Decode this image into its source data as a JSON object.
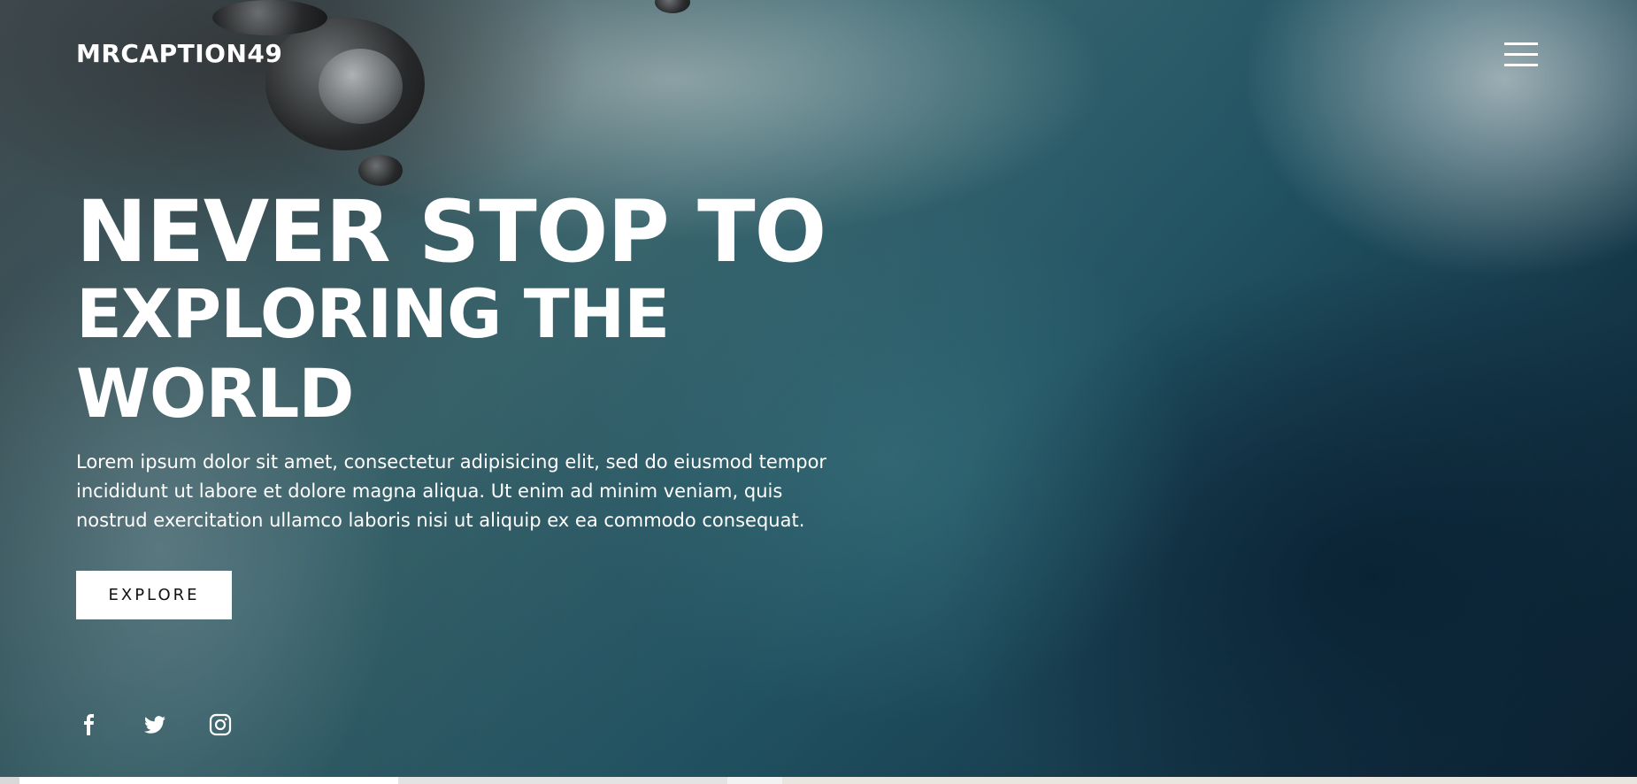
{
  "brand": {
    "logo_text": "MRCAPTION49"
  },
  "header": {
    "menu_icon": "hamburger-menu-icon"
  },
  "hero": {
    "title_line1": "NEVER STOP TO",
    "title_line2": "EXPLORING THE WORLD",
    "description": "Lorem ipsum dolor sit amet, consectetur adipisicing elit, sed do eiusmod tempor incididunt ut labore et dolore magna aliqua. Ut enim ad minim veniam, quis nostrud exercitation ullamco laboris nisi ut aliquip ex ea commodo consequat.",
    "button_label": "EXPLORE"
  },
  "social": {
    "items": [
      {
        "icon": "facebook-icon"
      },
      {
        "icon": "twitter-icon"
      },
      {
        "icon": "instagram-icon"
      }
    ]
  },
  "colors": {
    "text": "#ffffff",
    "button_bg": "#ffffff",
    "button_text": "#111111"
  }
}
